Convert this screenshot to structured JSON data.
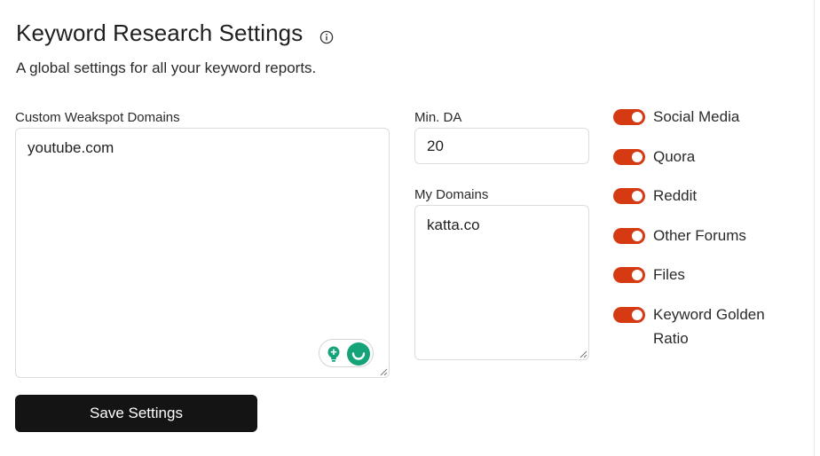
{
  "header": {
    "title": "Keyword Research Settings",
    "subtitle": "A global settings for all your keyword reports."
  },
  "weakspot": {
    "label": "Custom Weakspot Domains",
    "value": "youtube.com"
  },
  "min_da": {
    "label": "Min. DA",
    "value": "20"
  },
  "my_domains": {
    "label": "My Domains",
    "value": "katta.co"
  },
  "save_label": "Save Settings",
  "toggles": [
    {
      "label": "Social Media",
      "on": true
    },
    {
      "label": "Quora",
      "on": true
    },
    {
      "label": "Reddit",
      "on": true
    },
    {
      "label": "Other Forums",
      "on": true
    },
    {
      "label": "Files",
      "on": true
    },
    {
      "label": "Keyword Golden Ratio",
      "on": true
    }
  ],
  "colors": {
    "toggle_on": "#d63a12",
    "button_bg": "#141414",
    "grammar_green": "#15a37a"
  }
}
